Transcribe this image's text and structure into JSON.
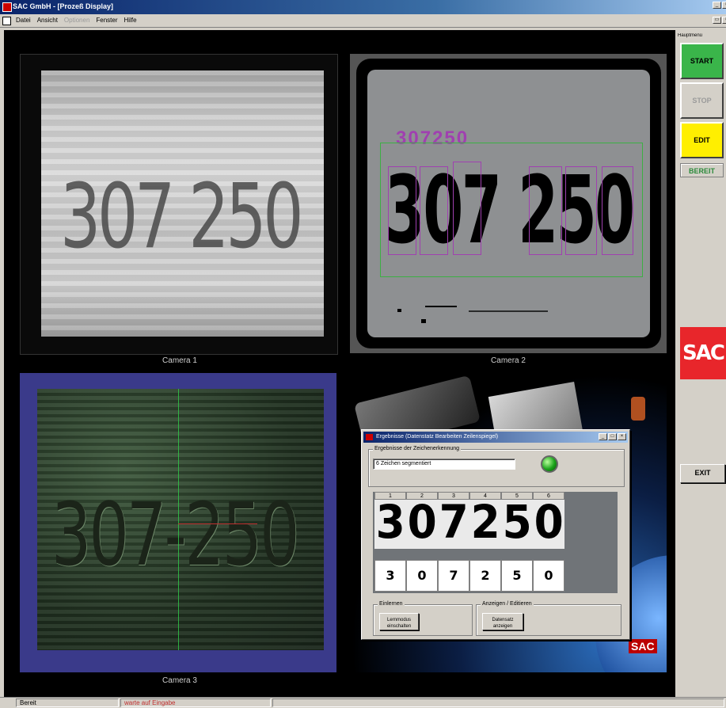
{
  "window": {
    "title": "SAC GmbH - [Prozeß Display]"
  },
  "menu": {
    "items": [
      "Datei",
      "Ansicht",
      "Optionen",
      "Fenster",
      "Hilfe"
    ],
    "disabled": [
      "Optionen"
    ]
  },
  "cameras": [
    {
      "caption": "Camera 1",
      "number": "307 250"
    },
    {
      "caption": "Camera 2",
      "number": "307 250",
      "recognized": "307250"
    },
    {
      "caption": "Camera 3",
      "number": "307-250"
    }
  ],
  "dialog": {
    "title": "Ergebnisse (Datenstatz Bearbeiten Zeilenspiegel)",
    "group_result_label": "Ergebnisse der Zeichenerkennung",
    "status_field": "6 Zeichen segmentiert",
    "status_led_color": "#1aa31a",
    "columns": [
      "1",
      "2",
      "3",
      "4",
      "5",
      "6"
    ],
    "segments": [
      "3",
      "0",
      "7",
      "2",
      "5",
      "0"
    ],
    "values": [
      "3",
      "0",
      "7",
      "2",
      "5",
      "0"
    ],
    "group_left_label": "Einlernen",
    "btn_left": "Lernmodus einschalten",
    "group_right_label": "Anzeigen / Editieren",
    "btn_right": "Datensatz anzeigen"
  },
  "right_panel": {
    "header": "Hauptmenü",
    "start": "START",
    "stop": "STOP",
    "edit": "EDIT",
    "status": "BEREIT",
    "logo": "SAC",
    "exit": "EXIT",
    "colors": {
      "start": "#3ab54a",
      "edit": "#ffef00",
      "logo": "#e8262b",
      "status": "#2a8a3a"
    }
  },
  "promo": {
    "logo": "SAC"
  },
  "statusbar": {
    "left": "Bereit",
    "middle": "warte auf Eingabe"
  }
}
